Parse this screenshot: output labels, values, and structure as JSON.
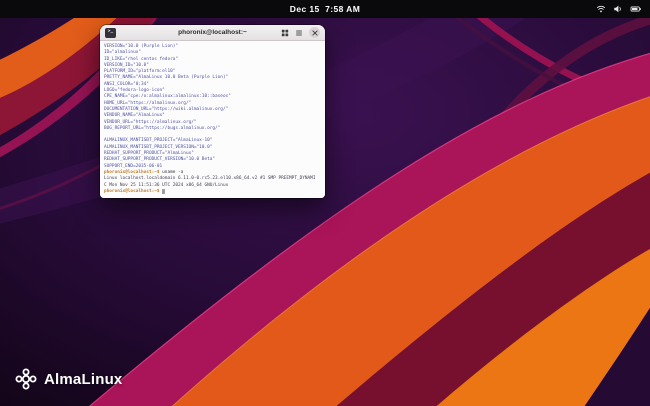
{
  "colors": {
    "prompt": "#c07a1e",
    "terminal_output": "#4d52a2",
    "wallpaper_base": "#1d0827",
    "wallpaper_orange": "#e2591a",
    "wallpaper_magenta": "#aa1458"
  },
  "top_bar": {
    "clock": "Dec 15  7:58 AM",
    "status_icons": [
      "network-icon",
      "volume-icon",
      "battery-icon"
    ]
  },
  "terminal": {
    "title": "phoronix@localhost:~",
    "header": {
      "app_icon_glyph": ">_",
      "icons": [
        "terminal-app-icon",
        "new-tab-icon",
        "menu-icon",
        "close-icon"
      ]
    },
    "output_lines": [
      [
        {
          "t": "VERSION=\"10.0 (Purple Lion)\"",
          "c": "out"
        }
      ],
      [
        {
          "t": "ID=\"almalinux\"",
          "c": "out"
        }
      ],
      [
        {
          "t": "ID_LIKE=\"rhel centos fedora\"",
          "c": "out"
        }
      ],
      [
        {
          "t": "VERSION_ID=\"10.0\"",
          "c": "out"
        }
      ],
      [
        {
          "t": "PLATFORM_ID=\"platform:el10\"",
          "c": "out"
        }
      ],
      [
        {
          "t": "PRETTY_NAME=\"AlmaLinux 10.0 Beta (Purple Lion)\"",
          "c": "out"
        }
      ],
      [
        {
          "t": "ANSI_COLOR=\"0;34\"",
          "c": "out"
        }
      ],
      [
        {
          "t": "LOGO=\"fedora-logo-icon\"",
          "c": "out"
        }
      ],
      [
        {
          "t": "CPE_NAME=\"cpe:/o:almalinux:almalinux:10::baseos\"",
          "c": "out"
        }
      ],
      [
        {
          "t": "HOME_URL=\"https://almalinux.org/\"",
          "c": "out"
        }
      ],
      [
        {
          "t": "DOCUMENTATION_URL=\"https://wiki.almalinux.org/\"",
          "c": "out"
        }
      ],
      [
        {
          "t": "VENDOR_NAME=\"AlmaLinux\"",
          "c": "out"
        }
      ],
      [
        {
          "t": "VENDOR_URL=\"https://almalinux.org/\"",
          "c": "out"
        }
      ],
      [
        {
          "t": "BUG_REPORT_URL=\"https://bugs.almalinux.org/\"",
          "c": "out"
        }
      ],
      [
        {
          "t": "",
          "c": "out"
        }
      ],
      [
        {
          "t": "ALMALINUX_MANTISBT_PROJECT=\"AlmaLinux-10\"",
          "c": "out"
        }
      ],
      [
        {
          "t": "ALMALINUX_MANTISBT_PROJECT_VERSION=\"10.0\"",
          "c": "out"
        }
      ],
      [
        {
          "t": "REDHAT_SUPPORT_PRODUCT=\"AlmaLinux\"",
          "c": "out"
        }
      ],
      [
        {
          "t": "REDHAT_SUPPORT_PRODUCT_VERSION=\"10.0 Beta\"",
          "c": "out"
        }
      ],
      [
        {
          "t": "SUPPORT_END=2035-06-01",
          "c": "out"
        }
      ],
      [
        {
          "t": "phoronix@localhost:~$ ",
          "c": "prompt"
        },
        {
          "t": "uname -a",
          "c": "cmd"
        }
      ],
      [
        {
          "t": "Linux localhost.localdomain 6.11.0-0.rc5.23.el10.x86_64.v2 #1 SMP PREEMPT_DYNAMI",
          "c": "plain"
        }
      ],
      [
        {
          "t": "C Mon Nov 25 11:51:36 UTC 2024 x86_64 GNU/Linux",
          "c": "plain"
        }
      ],
      [
        {
          "t": "phoronix@localhost:~$ ",
          "c": "prompt"
        },
        {
          "t": " ",
          "c": "cursor"
        }
      ]
    ]
  },
  "desktop": {
    "brand": "AlmaLinux"
  }
}
